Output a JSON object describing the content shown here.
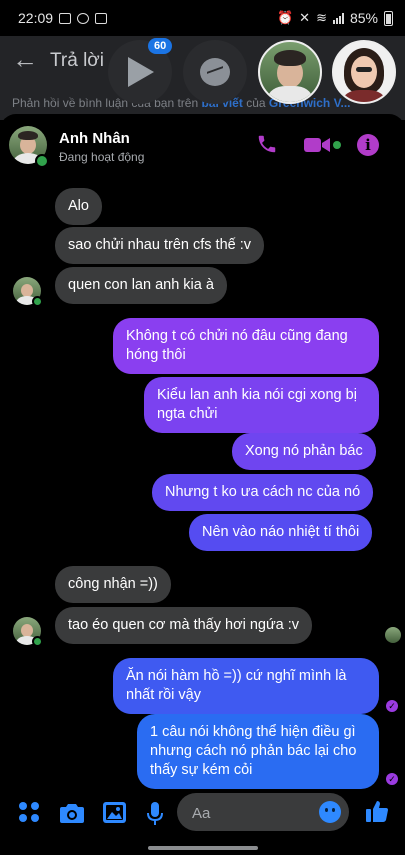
{
  "status_bar": {
    "time": "22:09",
    "battery": "85%"
  },
  "reply_header": {
    "title": "Trả lời",
    "subtitle_prefix": "Phản hồi về bình luận của bạn trên",
    "subtitle_link": "bài viết",
    "subtitle_middle": "của",
    "subtitle_link2": "Greenwich V..."
  },
  "chat_heads": {
    "badge_count": "60"
  },
  "contact": {
    "name": "Anh Nhân",
    "status": "Đang hoạt động"
  },
  "messages": [
    {
      "text": "Alo",
      "direction": "incoming"
    },
    {
      "text": "sao chửi nhau trên cfs thế :v",
      "direction": "incoming"
    },
    {
      "text": "quen con lan anh kia à",
      "direction": "incoming"
    },
    {
      "text": "Không t có chửi nó đâu cũng đang hóng thôi",
      "direction": "outgoing"
    },
    {
      "text": "Kiểu lan anh kia nói cgi xong bị ngta chửi",
      "direction": "outgoing"
    },
    {
      "text": "Xong nó phản bác",
      "direction": "outgoing"
    },
    {
      "text": "Nhưng t ko ưa cách nc của nó",
      "direction": "outgoing"
    },
    {
      "text": "Nên vào náo nhiệt tí thôi",
      "direction": "outgoing"
    },
    {
      "text": "công nhận =))",
      "direction": "incoming"
    },
    {
      "text": "tao éo quen cơ mà thấy hơi ngứa :v",
      "direction": "incoming"
    },
    {
      "text": "Ăn nói hàm hồ =)) cứ nghĩ mình là nhất rồi vậy",
      "direction": "outgoing"
    },
    {
      "text": "1 câu nói không thể hiện điều gì nhưng cách nó phản bác lại cho thấy sự kém cỏi",
      "direction": "outgoing"
    }
  ],
  "composer": {
    "placeholder": "Aa"
  },
  "colors": {
    "accent_purple": "#b13cc9",
    "messenger_blue": "#2e89ff",
    "incoming_bubble": "#3a3b3c",
    "outgoing_gradient_top": "#8a3ff0",
    "outgoing_gradient_bottom": "#2a6cf2",
    "online_green": "#31a24c"
  },
  "icons": [
    "back-arrow-icon",
    "play-icon",
    "messenger-icon",
    "phone-icon",
    "video-call-icon",
    "info-icon",
    "apps-icon",
    "camera-icon",
    "gallery-icon",
    "microphone-icon",
    "emoji-icon",
    "thumbs-up-icon"
  ]
}
